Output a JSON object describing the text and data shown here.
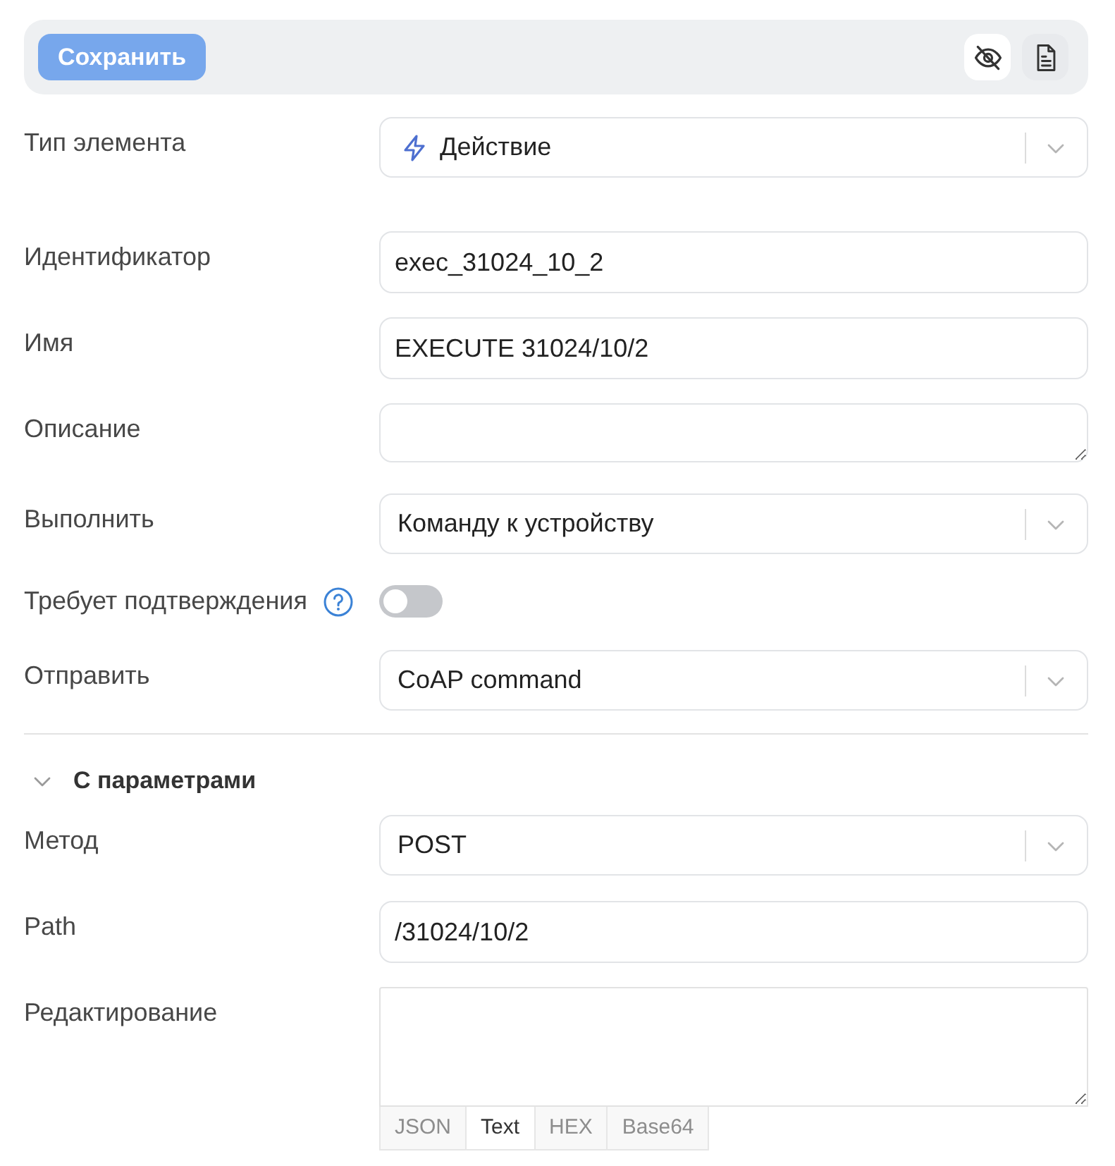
{
  "toolbar": {
    "save_button": {
      "label": "Сохранить",
      "disabled": true
    },
    "tools": [
      {
        "kind": "visibility",
        "selected": true
      },
      {
        "kind": "document",
        "selected": false
      }
    ]
  },
  "element_type": {
    "label": "Тип элемента",
    "value": "Действие"
  },
  "fields": [
    {
      "kind": "input",
      "label": "Идентификатор",
      "value": "exec_31024_10_2"
    },
    {
      "kind": "input",
      "label": "Имя",
      "value": "EXECUTE 31024/10/2"
    },
    {
      "kind": "textarea",
      "label": "Описание"
    },
    {
      "kind": "select",
      "label": "Выполнить",
      "value": "Команду к устройству"
    },
    {
      "kind": "toggle",
      "label": "Требует подтверждения",
      "on": false
    },
    {
      "kind": "select",
      "label": "Отправить",
      "value": "CoAP command"
    }
  ],
  "parameters": {
    "title": "С параметрами",
    "expanded": true,
    "fields": [
      {
        "kind": "select",
        "label": "Метод",
        "value": "POST"
      },
      {
        "kind": "input",
        "label": "Path",
        "value": "/31024/10/2"
      },
      {
        "kind": "editor",
        "label": "Редактирование",
        "formats": [
          {
            "label": "JSON",
            "selected": false
          },
          {
            "label": "Text",
            "selected": true
          },
          {
            "label": "HEX",
            "selected": false
          },
          {
            "label": "Base64",
            "selected": false
          }
        ]
      }
    ]
  }
}
